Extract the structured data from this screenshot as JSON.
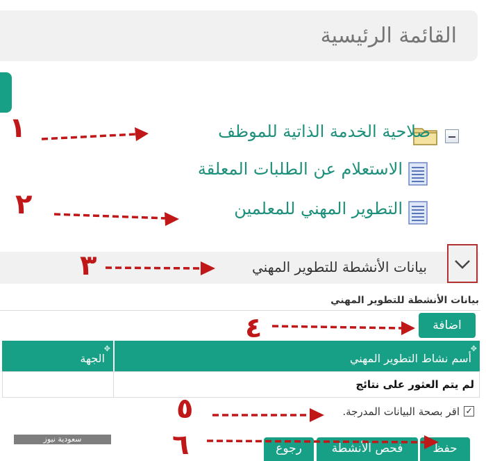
{
  "header": {
    "title": "القائمة الرئيسية"
  },
  "tree": {
    "folder_label": "صلاحية الخدمة الذاتية للموظف",
    "items": [
      {
        "label": "الاستعلام عن الطلبات المعلقة"
      },
      {
        "label": "التطوير المهني للمعلمين"
      }
    ]
  },
  "section": {
    "title": "بيانات الأنشطة للتطوير المهني",
    "subtitle": "بيانات الأنشطة للتطوير المهني"
  },
  "actions": {
    "add_label": "اضافة",
    "save_label": "حفظ",
    "check_label": "فحص الأنشطة",
    "back_label": "رجوع"
  },
  "table": {
    "columns": [
      "أسم نشاط التطوير المهني",
      "الجهة"
    ],
    "empty_message": "لم يتم العثور على نتائج"
  },
  "confirm": {
    "checked": true,
    "label": "اقر بصحة البيانات المدرجة."
  },
  "watermark": {
    "text": "سعودية نيوز"
  },
  "annotations": {
    "numbers": [
      "١",
      "٢",
      "٣",
      "٤",
      "٥",
      "٦"
    ],
    "color": "#c01818"
  },
  "colors": {
    "accent": "#17a085",
    "link": "#1d8f7a",
    "annotation": "#c01818"
  }
}
